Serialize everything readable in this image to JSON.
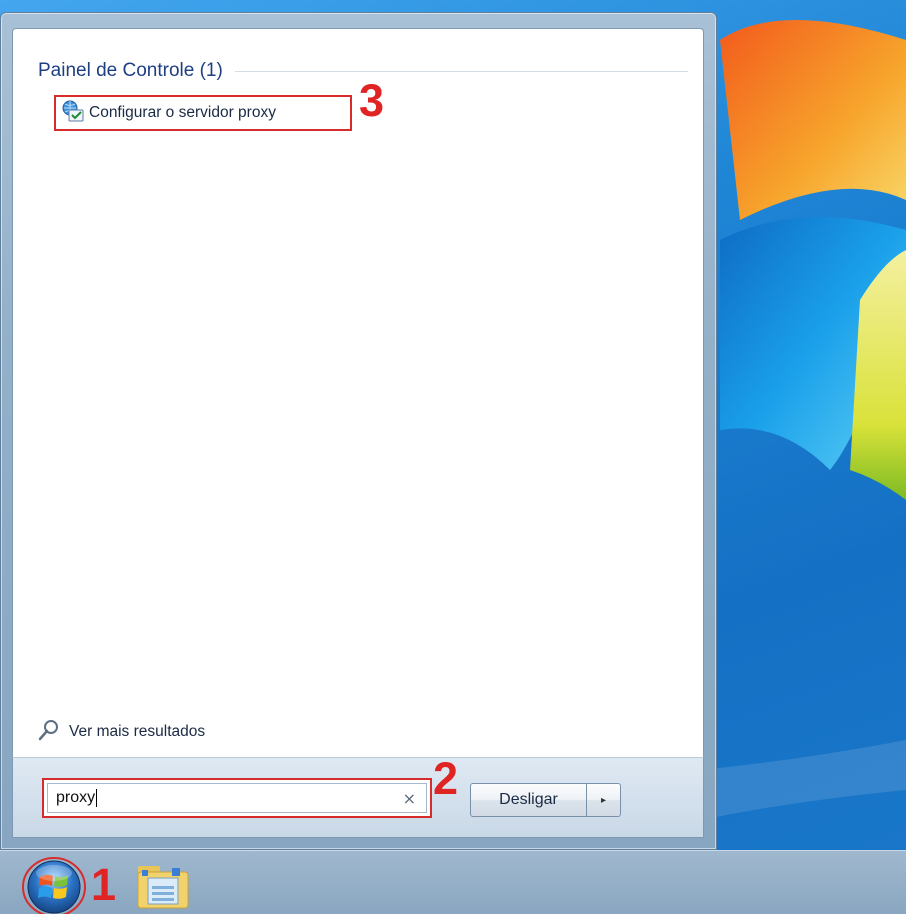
{
  "start_menu": {
    "section_header": "Painel de Controle (1)",
    "result_item": {
      "label": "Configurar o servidor proxy",
      "icon": "control-panel-network-icon"
    },
    "more_results_label": "Ver mais resultados",
    "search": {
      "value": "proxy",
      "clear_glyph": "×"
    },
    "shutdown": {
      "label": "Desligar",
      "arrow_glyph": "▸"
    }
  },
  "annotations": {
    "step1": "1",
    "step2": "2",
    "step3": "3"
  },
  "taskbar": {
    "items": [
      {
        "icon": "windows-start-orb-icon"
      },
      {
        "icon": "windows-explorer-folder-icon"
      }
    ]
  },
  "colors": {
    "annotation_red": "#d62c2c",
    "header_blue": "#1e3f82",
    "desktop_blue": "#1f86d6"
  }
}
